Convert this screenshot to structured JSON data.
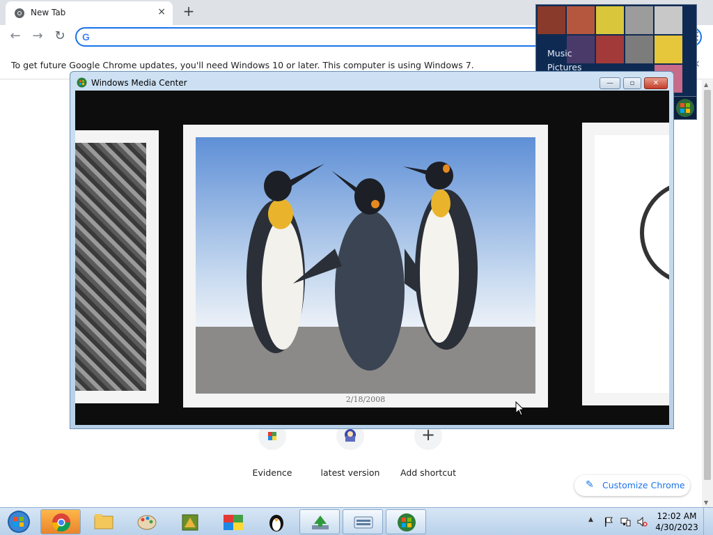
{
  "browser": {
    "tab_title": "New Tab",
    "tab_close": "×",
    "new_tab": "+",
    "nav": {
      "back": "←",
      "forward": "→",
      "reload": "↻"
    },
    "omnibox_value": "",
    "omnibox_g": "G",
    "menu": "⋮",
    "infobar_text": "To get future Google Chrome updates, you'll need Windows 10 or later. This computer is using Windows 7.",
    "infobar_close": "×"
  },
  "new_tab_page": {
    "shortcuts": [
      {
        "label": "Evidence",
        "icon": "evidence-icon"
      },
      {
        "label": "latest version",
        "icon": "latest-version-icon"
      },
      {
        "label": "Add shortcut",
        "icon": "plus-icon",
        "glyph": "+"
      }
    ],
    "customize_label": "Customize Chrome",
    "customize_icon": "✎"
  },
  "media_gadget": {
    "items": [
      "Music",
      "Pictures"
    ]
  },
  "media_center": {
    "title": "Windows Media Center",
    "controls": {
      "minimize": "—",
      "restore": "▫",
      "close": "✕"
    },
    "photo_date": "2/18/2008"
  },
  "taskbar": {
    "time": "12:02 AM",
    "date": "4/30/2023",
    "tray_chevron": "▲"
  },
  "colors": {
    "chrome_accent": "#1a73e8",
    "wmc_background": "#0d0d0d",
    "taskbar": "#c8dcf0"
  }
}
